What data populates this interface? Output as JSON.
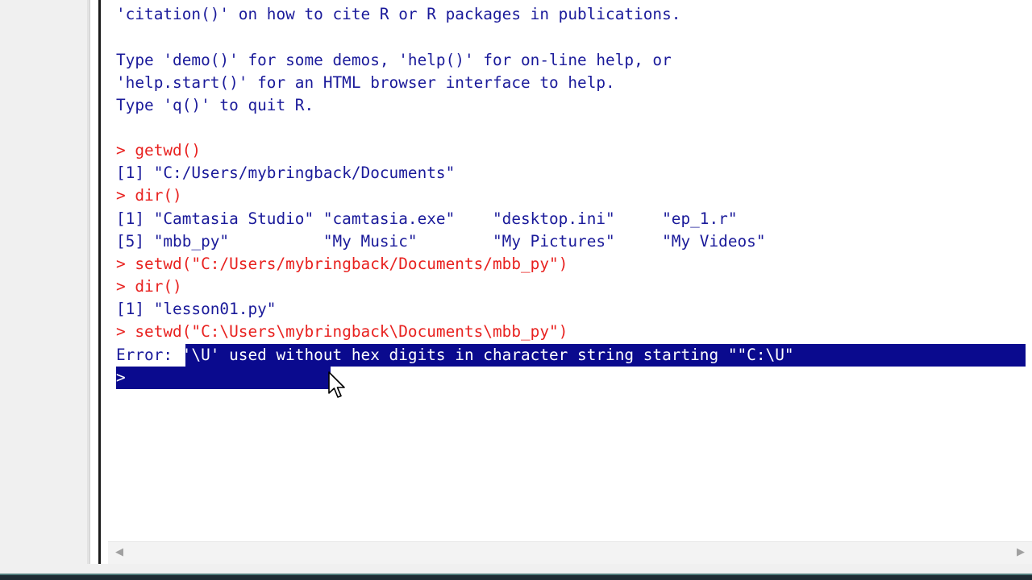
{
  "console": {
    "lines": [
      "'citation()' on how to cite R or R packages in publications.",
      "Type 'demo()' for some demos, 'help()' for on-line help, or",
      "'help.start()' for an HTML browser interface to help.",
      "Type 'q()' to quit R."
    ],
    "prompt": "> ",
    "cmd_getwd": "getwd()",
    "out_getwd": "[1] \"C:/Users/mybringback/Documents\"",
    "cmd_dir1": "dir()",
    "out_dir1_a": "[1] \"Camtasia Studio\" \"camtasia.exe\"    \"desktop.ini\"     \"ep_1.r\"",
    "out_dir1_b": "[5] \"mbb_py\"          \"My Music\"        \"My Pictures\"     \"My Videos\"",
    "cmd_setwd1": "setwd(\"C:/Users/mybringback/Documents/mbb_py\")",
    "cmd_dir2": "dir()",
    "out_dir2": "[1] \"lesson01.py\"",
    "cmd_setwd2": "setwd(\"C:\\Users\\mybringback\\Documents\\mbb_py\")",
    "error_label": "Error:",
    "error_message": " '\\U' used without hex digits in character string starting \"\"C:\\U\"",
    "final_prompt": ">"
  },
  "colors": {
    "output_text": "#1a1a9a",
    "command_text": "#e8211f",
    "selection_bg": "#0a0a8e"
  },
  "icons": {
    "scroll_left": "scroll-left-arrow-icon",
    "scroll_right": "scroll-right-arrow-icon",
    "mouse_cursor": "mouse-pointer-icon"
  }
}
